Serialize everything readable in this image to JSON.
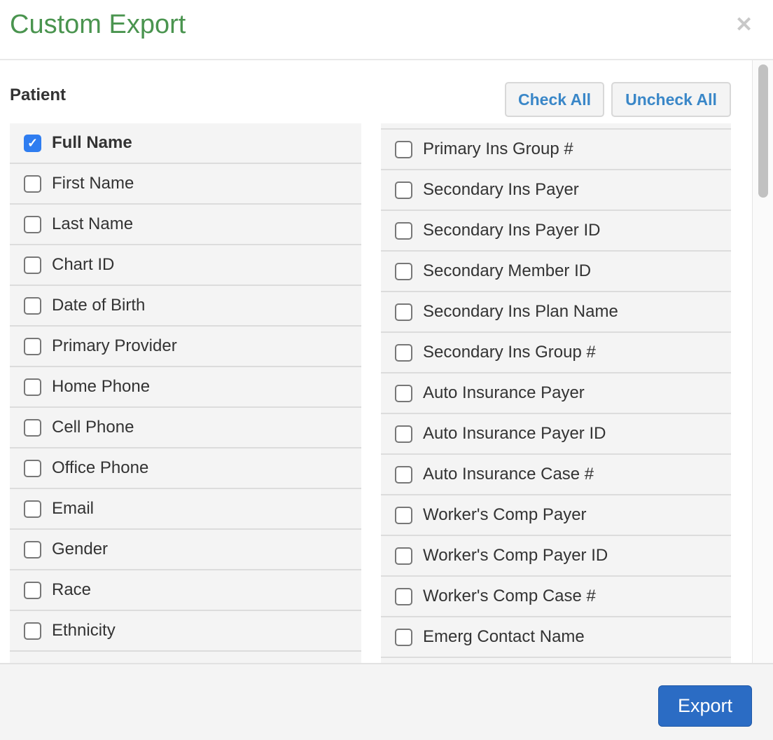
{
  "dialog": {
    "title": "Custom Export",
    "close_icon": "close-icon"
  },
  "section": {
    "title": "Patient",
    "check_all": "Check All",
    "uncheck_all": "Uncheck All"
  },
  "left_fields": [
    {
      "label": "Full Name",
      "checked": true
    },
    {
      "label": "First Name",
      "checked": false
    },
    {
      "label": "Last Name",
      "checked": false
    },
    {
      "label": "Chart ID",
      "checked": false
    },
    {
      "label": "Date of Birth",
      "checked": false
    },
    {
      "label": "Primary Provider",
      "checked": false
    },
    {
      "label": "Home Phone",
      "checked": false
    },
    {
      "label": "Cell Phone",
      "checked": false
    },
    {
      "label": "Office Phone",
      "checked": false
    },
    {
      "label": "Email",
      "checked": false
    },
    {
      "label": "Gender",
      "checked": false
    },
    {
      "label": "Race",
      "checked": false
    },
    {
      "label": "Ethnicity",
      "checked": false
    }
  ],
  "right_fields": [
    {
      "label": "Primary Ins Group #",
      "checked": false
    },
    {
      "label": "Secondary Ins Payer",
      "checked": false
    },
    {
      "label": "Secondary Ins Payer ID",
      "checked": false
    },
    {
      "label": "Secondary Member ID",
      "checked": false
    },
    {
      "label": "Secondary Ins Plan Name",
      "checked": false
    },
    {
      "label": "Secondary Ins Group #",
      "checked": false
    },
    {
      "label": "Auto Insurance Payer",
      "checked": false
    },
    {
      "label": "Auto Insurance Payer ID",
      "checked": false
    },
    {
      "label": "Auto Insurance Case #",
      "checked": false
    },
    {
      "label": "Worker's Comp Payer",
      "checked": false
    },
    {
      "label": "Worker's Comp Payer ID",
      "checked": false
    },
    {
      "label": "Worker's Comp Case #",
      "checked": false
    },
    {
      "label": "Emerg Contact Name",
      "checked": false
    }
  ],
  "footer": {
    "export_label": "Export"
  },
  "colors": {
    "title": "#4a944f",
    "accent": "#2b6cc4",
    "link": "#3a87c8",
    "checkbox": "#2f7df0"
  }
}
